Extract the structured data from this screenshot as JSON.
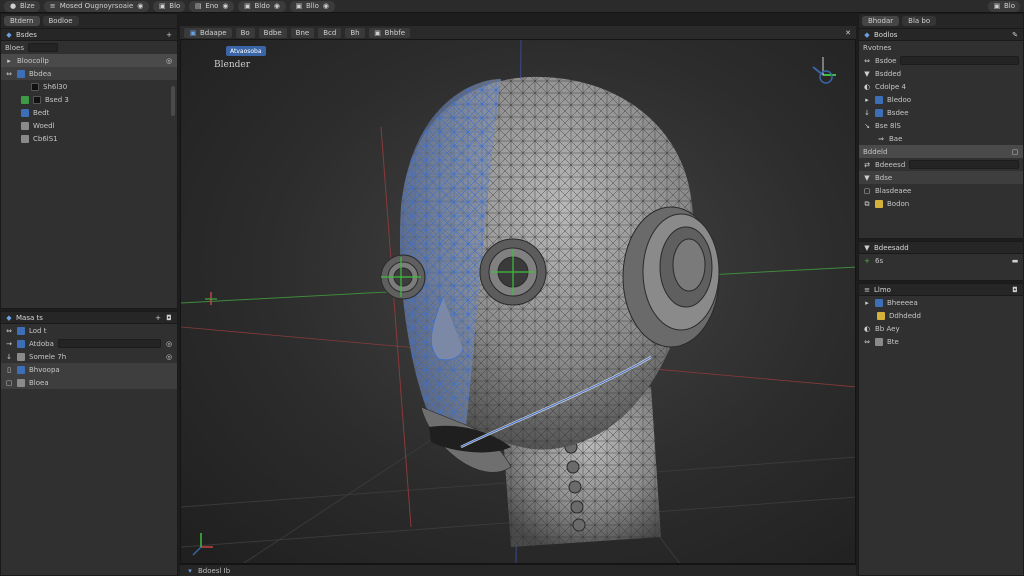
{
  "topbar": {
    "items": [
      {
        "icon": "app-logo-icon",
        "label": "Blze"
      },
      {
        "icon": "menu-icon",
        "label": "Mosed  Ougnoyrsoaie"
      },
      {
        "icon": "layout-icon",
        "label": "Blo"
      },
      {
        "icon": "edit-icon",
        "label": "Eno"
      },
      {
        "icon": "view-icon",
        "label": "Bldo"
      },
      {
        "icon": "render-icon",
        "label": "Bllo"
      },
      {
        "icon": "settings-icon",
        "label": "Blo"
      }
    ]
  },
  "outliner": {
    "title": "Bsdes",
    "tabs": [
      "Btdern",
      "Bodloe"
    ],
    "search_label": "Bloes",
    "collection_label": "Bloocollp",
    "items": [
      {
        "label": "Bbdea",
        "color": "#3c6fb8"
      },
      {
        "label": "Sh6l30",
        "color": "#111111"
      },
      {
        "label": "Bsed 3",
        "color": "#3e9a46"
      },
      {
        "label": "Bedt",
        "color": "#3c6fb8"
      },
      {
        "label": "Woedl",
        "color": "#8a8a8a"
      },
      {
        "label": "Cb6lS1",
        "color": "#8a8a8a"
      }
    ]
  },
  "layers": {
    "title": "Masa ts",
    "items": [
      {
        "label": "Lod t",
        "color": "#3c6fb8"
      },
      {
        "label": "Atdoba",
        "color": "#3c6fb8"
      },
      {
        "label": "Somele 7h",
        "color": "#8a8a8a"
      },
      {
        "label": "Bhvoopa",
        "color": "#3c6fb8"
      },
      {
        "label": "Bloea",
        "color": "#8a8a8a"
      }
    ]
  },
  "viewport": {
    "header_items": [
      "Bdaape",
      "Bo",
      "Bdbe",
      "Bne",
      "Bcd",
      "Bh",
      "Bhbfe"
    ],
    "header_active": "Atvaosoba",
    "scene_label": "Blender",
    "status": "Bdoesl  Ib"
  },
  "properties": {
    "header_tabs": [
      "Bhodar",
      "Bla bo"
    ],
    "title": "Bodlos",
    "section_label": "Rvotnes",
    "items": [
      {
        "label": "Bsdoe"
      },
      {
        "label": "Bsdded"
      },
      {
        "label": "Cdolpe 4"
      },
      {
        "label": "Bledoo"
      },
      {
        "label": "Bsdee"
      },
      {
        "label": "Bse  8lS"
      },
      {
        "label": "Bae"
      }
    ],
    "material_header": "Bddeld",
    "material_items": [
      "Bdeeesd",
      "Bdse",
      "Blasdeaee",
      "Bodon"
    ]
  },
  "modifier": {
    "title": "Bdeesadd",
    "value": "6s"
  },
  "data_panel": {
    "title": "Llmo",
    "items": [
      "Bheeeea",
      "Ddhdedd",
      "Bb Aey",
      "Bte"
    ]
  },
  "colors": {
    "accent_blue": "#3a66a8",
    "panel_bg": "#303030",
    "header_bg": "#262626",
    "wire_blue": "#3b6fd0"
  }
}
